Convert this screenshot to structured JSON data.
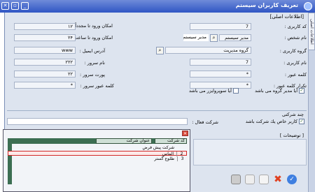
{
  "window": {
    "title": "تعريف كاربران سيستم",
    "side_tab": "اطلاعات اصلی"
  },
  "section_title": "[اطلاعات اصلی]",
  "form": {
    "user_code": {
      "label": "كد كاربری :",
      "value": "7"
    },
    "person_name": {
      "label": "نام شخص :",
      "value": "مدير سيستم",
      "value2": "مدير سيستم"
    },
    "user_group": {
      "label": "گروه كاربری :",
      "value": "گروه مديريت"
    },
    "user_name": {
      "label": "نام كاربری :",
      "value": "7"
    },
    "password": {
      "label": "كلمه عبور :",
      "value": "*"
    },
    "password_repeat": {
      "label": "تكرار كلمه عبور :",
      "value": "*"
    },
    "is_manager": {
      "label": "آيا مدير گروه می باشد",
      "checked": true
    },
    "is_supervisor": {
      "label": "آيا سوپروايزر می باشد",
      "checked": false
    },
    "login_repeat": {
      "label": "امكان ورود تا مجدداً :",
      "value": "١٢"
    },
    "login_hours": {
      "label": "امكان ورود تا ساعت :",
      "value": "٢۴"
    },
    "email": {
      "label": "آدرس ايميل :",
      "value": "www"
    },
    "server_name": {
      "label": "نام سرور :",
      "value": "٢٢٢"
    },
    "server_port": {
      "label": "پورت سرور :",
      "value": "٢٢"
    },
    "server_password": {
      "label": "كلمه عبور سرور :",
      "value": "*"
    }
  },
  "multi_company": {
    "label": "چند شركتی",
    "checkbox_label": "كاربر خاص يك شركت باشد",
    "checked": true,
    "active_company_label": "شركت فعال :"
  },
  "notes": {
    "label": "[ توضيحات ]"
  },
  "popup": {
    "headers": {
      "code": "كد شركت",
      "name": "عنوان شركت"
    },
    "rows": [
      {
        "code": "",
        "name": "شركت پيش فرض"
      },
      {
        "code": "2",
        "name": "الماس"
      },
      {
        "code": "3",
        "name": "طلوع گستر"
      }
    ]
  },
  "colors": {
    "titlebar": "#2f55c4",
    "form_bg": "#dde4ef",
    "popup_header": "#3c6e52",
    "selection": "#d12a2a"
  }
}
